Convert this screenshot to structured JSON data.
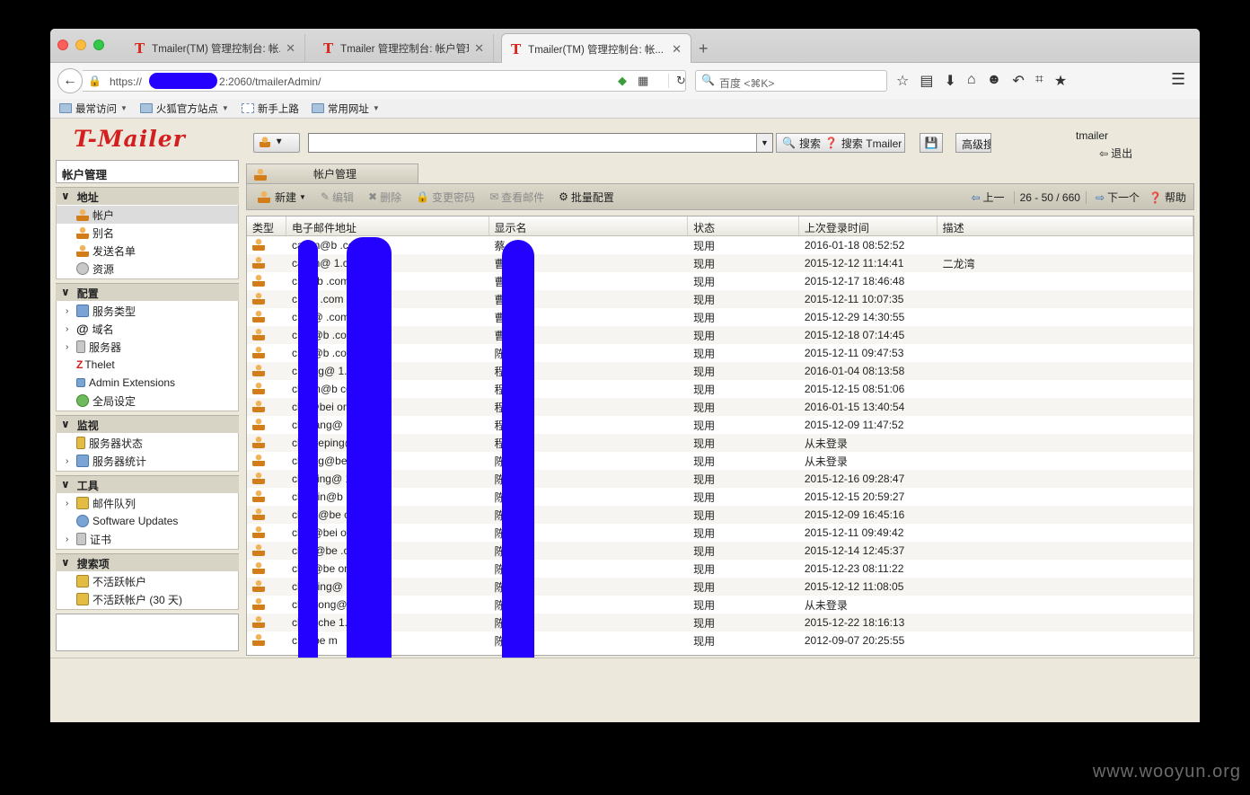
{
  "browser": {
    "tabs": [
      {
        "title": "Tmailer(TM) 管理控制台: 帐..."
      },
      {
        "title": "Tmailer 管理控制台: 帐户管理"
      },
      {
        "title": "Tmailer(TM) 管理控制台: 帐..."
      }
    ],
    "url_prefix": "https://",
    "url_suffix": "2:2060/tmailerAdmin/",
    "search_placeholder": "百度 <⌘K>",
    "bookmarks": [
      "最常访问",
      "火狐官方站点",
      "新手上路",
      "常用网址"
    ]
  },
  "app": {
    "logo": "T-Mailer",
    "search_button": "搜索",
    "search_tmailer": "搜索 Tmailer",
    "advanced": "高级搜",
    "username": "tmailer",
    "logout": "退出"
  },
  "sidebar": {
    "header": "帐户管理",
    "sections": [
      {
        "title": "地址",
        "items": [
          {
            "label": "帐户",
            "icon": "person-icon",
            "selected": true
          },
          {
            "label": "别名",
            "icon": "alias-icon"
          },
          {
            "label": "发送名单",
            "icon": "distribution-list-icon"
          },
          {
            "label": "资源",
            "icon": "resource-icon"
          }
        ]
      },
      {
        "title": "配置",
        "items": [
          {
            "label": "服务类型",
            "icon": "class-of-service-icon",
            "expandable": true
          },
          {
            "label": "域名",
            "icon": "at-icon",
            "expandable": true
          },
          {
            "label": "服务器",
            "icon": "server-icon",
            "expandable": true
          },
          {
            "label": "Thelet",
            "icon": "zimlet-icon"
          },
          {
            "label": "Admin Extensions",
            "icon": "extension-icon"
          },
          {
            "label": "全局设定",
            "icon": "globe-icon"
          }
        ]
      },
      {
        "title": "监视",
        "items": [
          {
            "label": "服务器状态",
            "icon": "server-status-icon"
          },
          {
            "label": "服务器统计",
            "icon": "statistics-icon",
            "expandable": true
          }
        ]
      },
      {
        "title": "工具",
        "items": [
          {
            "label": "邮件队列",
            "icon": "mail-queue-icon",
            "expandable": true
          },
          {
            "label": "Software Updates",
            "icon": "updates-icon"
          },
          {
            "label": "证书",
            "icon": "certificate-icon",
            "expandable": true
          }
        ]
      },
      {
        "title": "搜索项",
        "items": [
          {
            "label": "不活跃帐户",
            "icon": "search-folder-icon"
          },
          {
            "label": "不活跃帐户 (30 天)",
            "icon": "search-folder-icon"
          }
        ]
      }
    ]
  },
  "content": {
    "tab": "帐户管理",
    "toolbar": {
      "new": "新建",
      "edit": "编辑",
      "delete": "删除",
      "change_password": "变更密码",
      "view_mail": "查看邮件",
      "batch": "批量配置"
    },
    "pager": {
      "prev": "上一",
      "range": "26 - 50 / 660",
      "next": "下一个",
      "help": "帮助"
    },
    "columns": [
      "类型",
      "电子邮件地址",
      "显示名",
      "状态",
      "上次登录时间",
      "描述"
    ],
    "rows": [
      {
        "email": "caiz   n@b        .com",
        "display": "蔡",
        "status": "现用",
        "last": "2016-01-18 08:52:52",
        "desc": ""
      },
      {
        "email": "ca   yin@          1.com",
        "display": "曹",
        "status": "现用",
        "last": "2015-12-12 11:14:41",
        "desc": "二龙湾"
      },
      {
        "email": "c    e@b          .com",
        "display": "曹",
        "status": "现用",
        "last": "2015-12-17 18:46:48",
        "desc": ""
      },
      {
        "email": "c    @b          .com",
        "display": "曹",
        "status": "现用",
        "last": "2015-12-11 10:07:35",
        "desc": ""
      },
      {
        "email": "c    ng@          .com",
        "display": "曹",
        "status": "现用",
        "last": "2015-12-29 14:30:55",
        "desc": ""
      },
      {
        "email": "c    en@b          .com",
        "display": "曹",
        "status": "现用",
        "last": "2015-12-18 07:14:45",
        "desc": ""
      },
      {
        "email": "c    ng@b          .com",
        "display": "陈",
        "status": "现用",
        "last": "2015-12-11 09:47:53",
        "desc": ""
      },
      {
        "email": "c    gang@          1.com",
        "display": "程",
        "status": "现用",
        "last": "2016-01-04 08:13:58",
        "desc": ""
      },
      {
        "email": "ch    jun@b          com",
        "display": "程",
        "status": "现用",
        "last": "2015-12-15 08:51:06",
        "desc": ""
      },
      {
        "email": "ch    i@bei          om",
        "display": "程",
        "status": "现用",
        "last": "2016-01-15 13:40:54",
        "desc": ""
      },
      {
        "email": "ch    xiang@          1.com",
        "display": "程",
        "status": "现用",
        "last": "2015-12-09 11:47:52",
        "desc": ""
      },
      {
        "email": "che    ueping@          1.com",
        "display": "程",
        "status": "现用",
        "last": "从未登录",
        "desc": ""
      },
      {
        "email": "che    ng@be          m",
        "display": "陈",
        "status": "现用",
        "last": "从未登录",
        "desc": ""
      },
      {
        "email": "che    iling@          1.com",
        "display": "陈",
        "status": "现用",
        "last": "2015-12-16 09:28:47",
        "desc": ""
      },
      {
        "email": "che    xin@b          .com",
        "display": "陈",
        "status": "现用",
        "last": "2015-12-15 20:59:27",
        "desc": ""
      },
      {
        "email": "che    g@be          com",
        "display": "陈",
        "status": "现用",
        "last": "2015-12-09 16:45:16",
        "desc": ""
      },
      {
        "email": "che    @bei          om",
        "display": "陈",
        "status": "现用",
        "last": "2015-12-11 09:49:42",
        "desc": ""
      },
      {
        "email": "che    i@be          .com",
        "display": "陈",
        "status": "现用",
        "last": "2015-12-14 12:45:37",
        "desc": ""
      },
      {
        "email": "che    @be          om",
        "display": "陈",
        "status": "现用",
        "last": "2015-12-23 08:11:22",
        "desc": ""
      },
      {
        "email": "che    ying@          1.com",
        "display": "陈",
        "status": "现用",
        "last": "2015-12-12 11:08:05",
        "desc": ""
      },
      {
        "email": "che    dong@          .com",
        "display": "陈",
        "status": "现用",
        "last": "从未登录",
        "desc": ""
      },
      {
        "email": "ch    nuche          1.com",
        "display": "陈",
        "status": "现用",
        "last": "2015-12-22 18:16:13",
        "desc": ""
      },
      {
        "email": "c    i@be          m",
        "display": "陈",
        "status": "现用",
        "last": "2012-09-07 20:25:55",
        "desc": ""
      }
    ]
  },
  "watermark": "www.wooyun.org",
  "colors": {
    "redaction": "#2400ff",
    "logo": "#d31f1f"
  }
}
